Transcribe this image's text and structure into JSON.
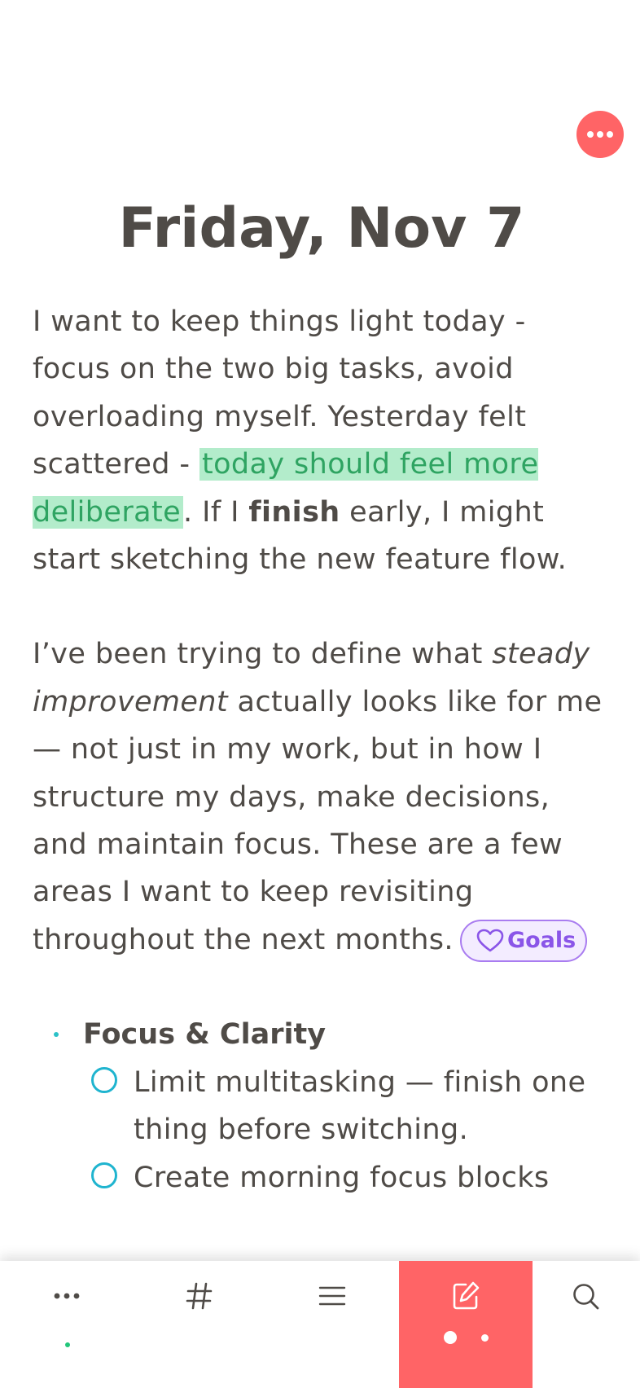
{
  "note": {
    "title": "Friday, Nov 7",
    "para1": {
      "text_a": "I want to keep things light today - focus on the two big tasks, avoid overloading myself. Yesterday felt scattered - ",
      "highlight": "today should feel more deliberate",
      "text_b": ". If I ",
      "bold": "finish",
      "text_c": " early, I might start sketching the new feature flow."
    },
    "para2": {
      "text_a": "I’ve been trying to define what ",
      "italic": "steady improvement",
      "text_b": " actually looks like for me — not just in my work, but in how I structure my days, make decisions, and maintain focus. These are a few areas I want to keep revisiting throughout the next months.",
      "tag_label": "Goals"
    },
    "list": {
      "heading": "Focus & Clarity",
      "todos": [
        "Limit multitasking — finish one thing before switching.",
        "Create morning focus blocks"
      ]
    }
  },
  "icons": {
    "more_fab": "more-horizontal-icon",
    "tabs": [
      "more-horizontal-icon",
      "hashtag-icon",
      "menu-lines-icon",
      "edit-note-icon",
      "search-icon"
    ]
  },
  "colors": {
    "accent": "#ff6466",
    "text": "#4f4b47",
    "highlight_bg": "#b3eccb",
    "highlight_text": "#2fa462",
    "tag": "#8a55e8",
    "todo_circle": "#1fb4cf",
    "bullet": "#2bc1c8",
    "sync_dot": "#22c67a"
  }
}
